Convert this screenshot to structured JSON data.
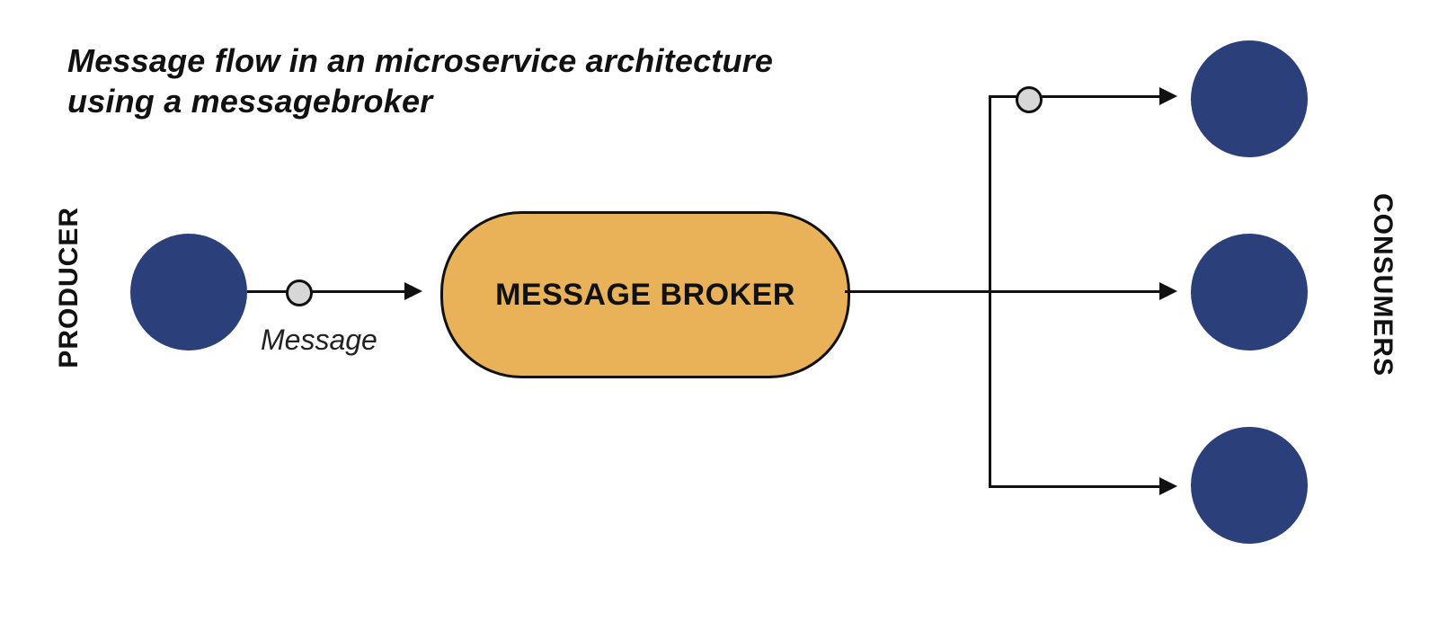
{
  "title_line1": "Message flow in an microservice architecture",
  "title_line2": "using a messagebroker",
  "producer_label": "PRODUCER",
  "broker_label": "MESSAGE BROKER",
  "message_label": "Message",
  "consumers_label": "CONSUMERS",
  "colors": {
    "node": "#2b3f7b",
    "broker_fill": "#e9b258",
    "stroke": "#111111",
    "msg_dot": "#d7d7d7"
  },
  "diagram": {
    "producer_count": 1,
    "consumer_count": 3,
    "message_dots": 2,
    "flow": [
      "PRODUCER",
      "MESSAGE BROKER",
      "CONSUMERS"
    ]
  }
}
